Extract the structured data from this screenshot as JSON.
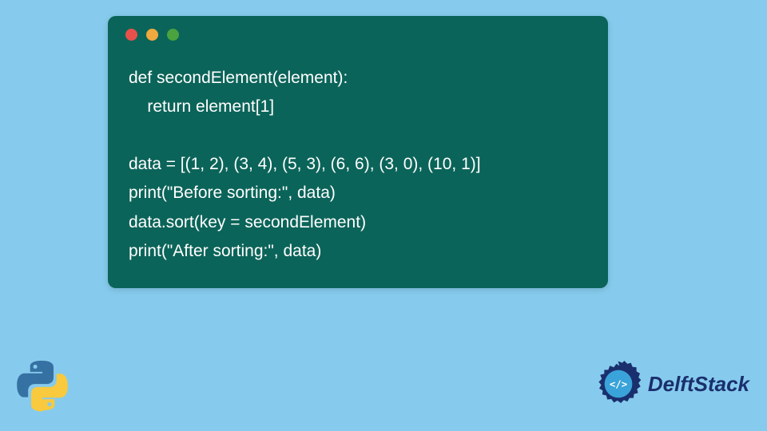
{
  "code": {
    "lines": [
      "def secondElement(element):",
      "    return element[1]",
      "",
      "data = [(1, 2), (3, 4), (5, 3), (6, 6), (3, 0), (10, 1)]",
      "print(\"Before sorting:\", data)",
      "data.sort(key = secondElement)",
      "print(\"After sorting:\", data)"
    ]
  },
  "branding": {
    "delftstack_label": "DelftStack"
  },
  "window_dots": {
    "red": "#e8514b",
    "yellow": "#f0a93e",
    "green": "#4aa33f"
  }
}
